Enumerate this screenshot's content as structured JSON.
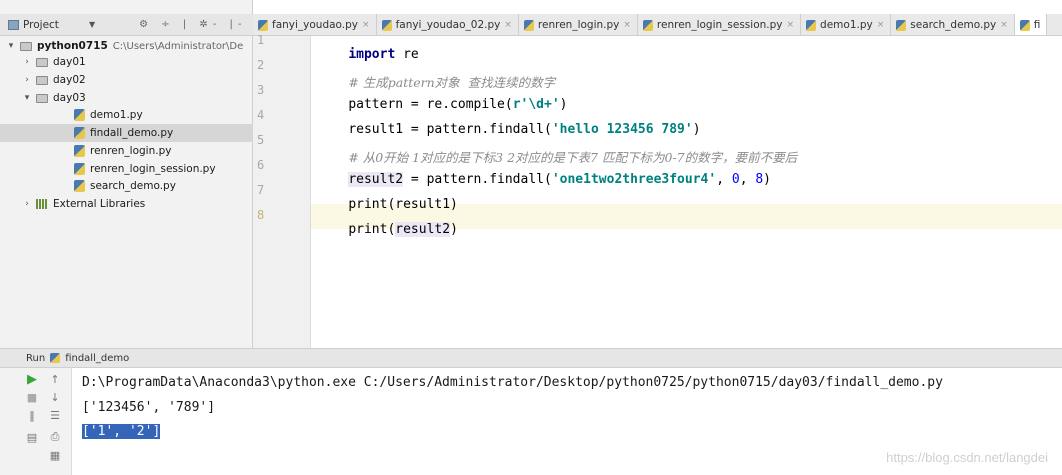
{
  "project_panel": {
    "title": "Project",
    "tools": "⚙ ÷ | ✲- |-",
    "tree": [
      {
        "label": "python0715",
        "path": "C:\\Users\\Administrator\\De"
      },
      {
        "label": "day01"
      },
      {
        "label": "day02"
      },
      {
        "label": "day03"
      },
      {
        "label": "demo1.py"
      },
      {
        "label": "findall_demo.py"
      },
      {
        "label": "renren_login.py"
      },
      {
        "label": "renren_login_session.py"
      },
      {
        "label": "search_demo.py"
      },
      {
        "label": "External Libraries"
      }
    ]
  },
  "tabs": [
    {
      "label": "fanyi_youdao.py"
    },
    {
      "label": "fanyi_youdao_02.py"
    },
    {
      "label": "renren_login.py"
    },
    {
      "label": "renren_login_session.py"
    },
    {
      "label": "demo1.py"
    },
    {
      "label": "search_demo.py"
    },
    {
      "label": "fi"
    }
  ],
  "editor": {
    "line_numbers": [
      "1",
      "2",
      "3",
      "4",
      "5",
      "6",
      "7",
      "8"
    ],
    "code": {
      "l1_kw": "import",
      "l1_rest": " re",
      "l2": "# 生成pattern对象  查找连续的数字",
      "l3_a": "pattern = re.compile(",
      "l3_str": "r'\\d+'",
      "l3_b": ")",
      "l4_a": "result1 = pattern.findall(",
      "l4_str": "'hello 123456 789'",
      "l4_b": ")",
      "l5": "# 从0开始 1对应的是下标3 2对应的是下表7 匹配下标为0-7的数字，要前不要后",
      "l6_var": "result2",
      "l6_a": " = pattern.findall(",
      "l6_str": "'one1two2three3four4'",
      "l6_b": ", ",
      "l6_n1": "0",
      "l6_c": ", ",
      "l6_n2": "8",
      "l6_d": ")",
      "l7": "print(result1)",
      "l8_a": "print(",
      "l8_var": "result2",
      "l8_b": ")"
    }
  },
  "run_panel": {
    "label": "Run",
    "config": "findall_demo",
    "output": [
      "D:\\ProgramData\\Anaconda3\\python.exe C:/Users/Administrator/Desktop/python0725/python0715/day03/findall_demo.py",
      "['123456', '789']",
      "['1', '2']"
    ]
  },
  "watermark": "https://blog.csdn.net/langdei"
}
